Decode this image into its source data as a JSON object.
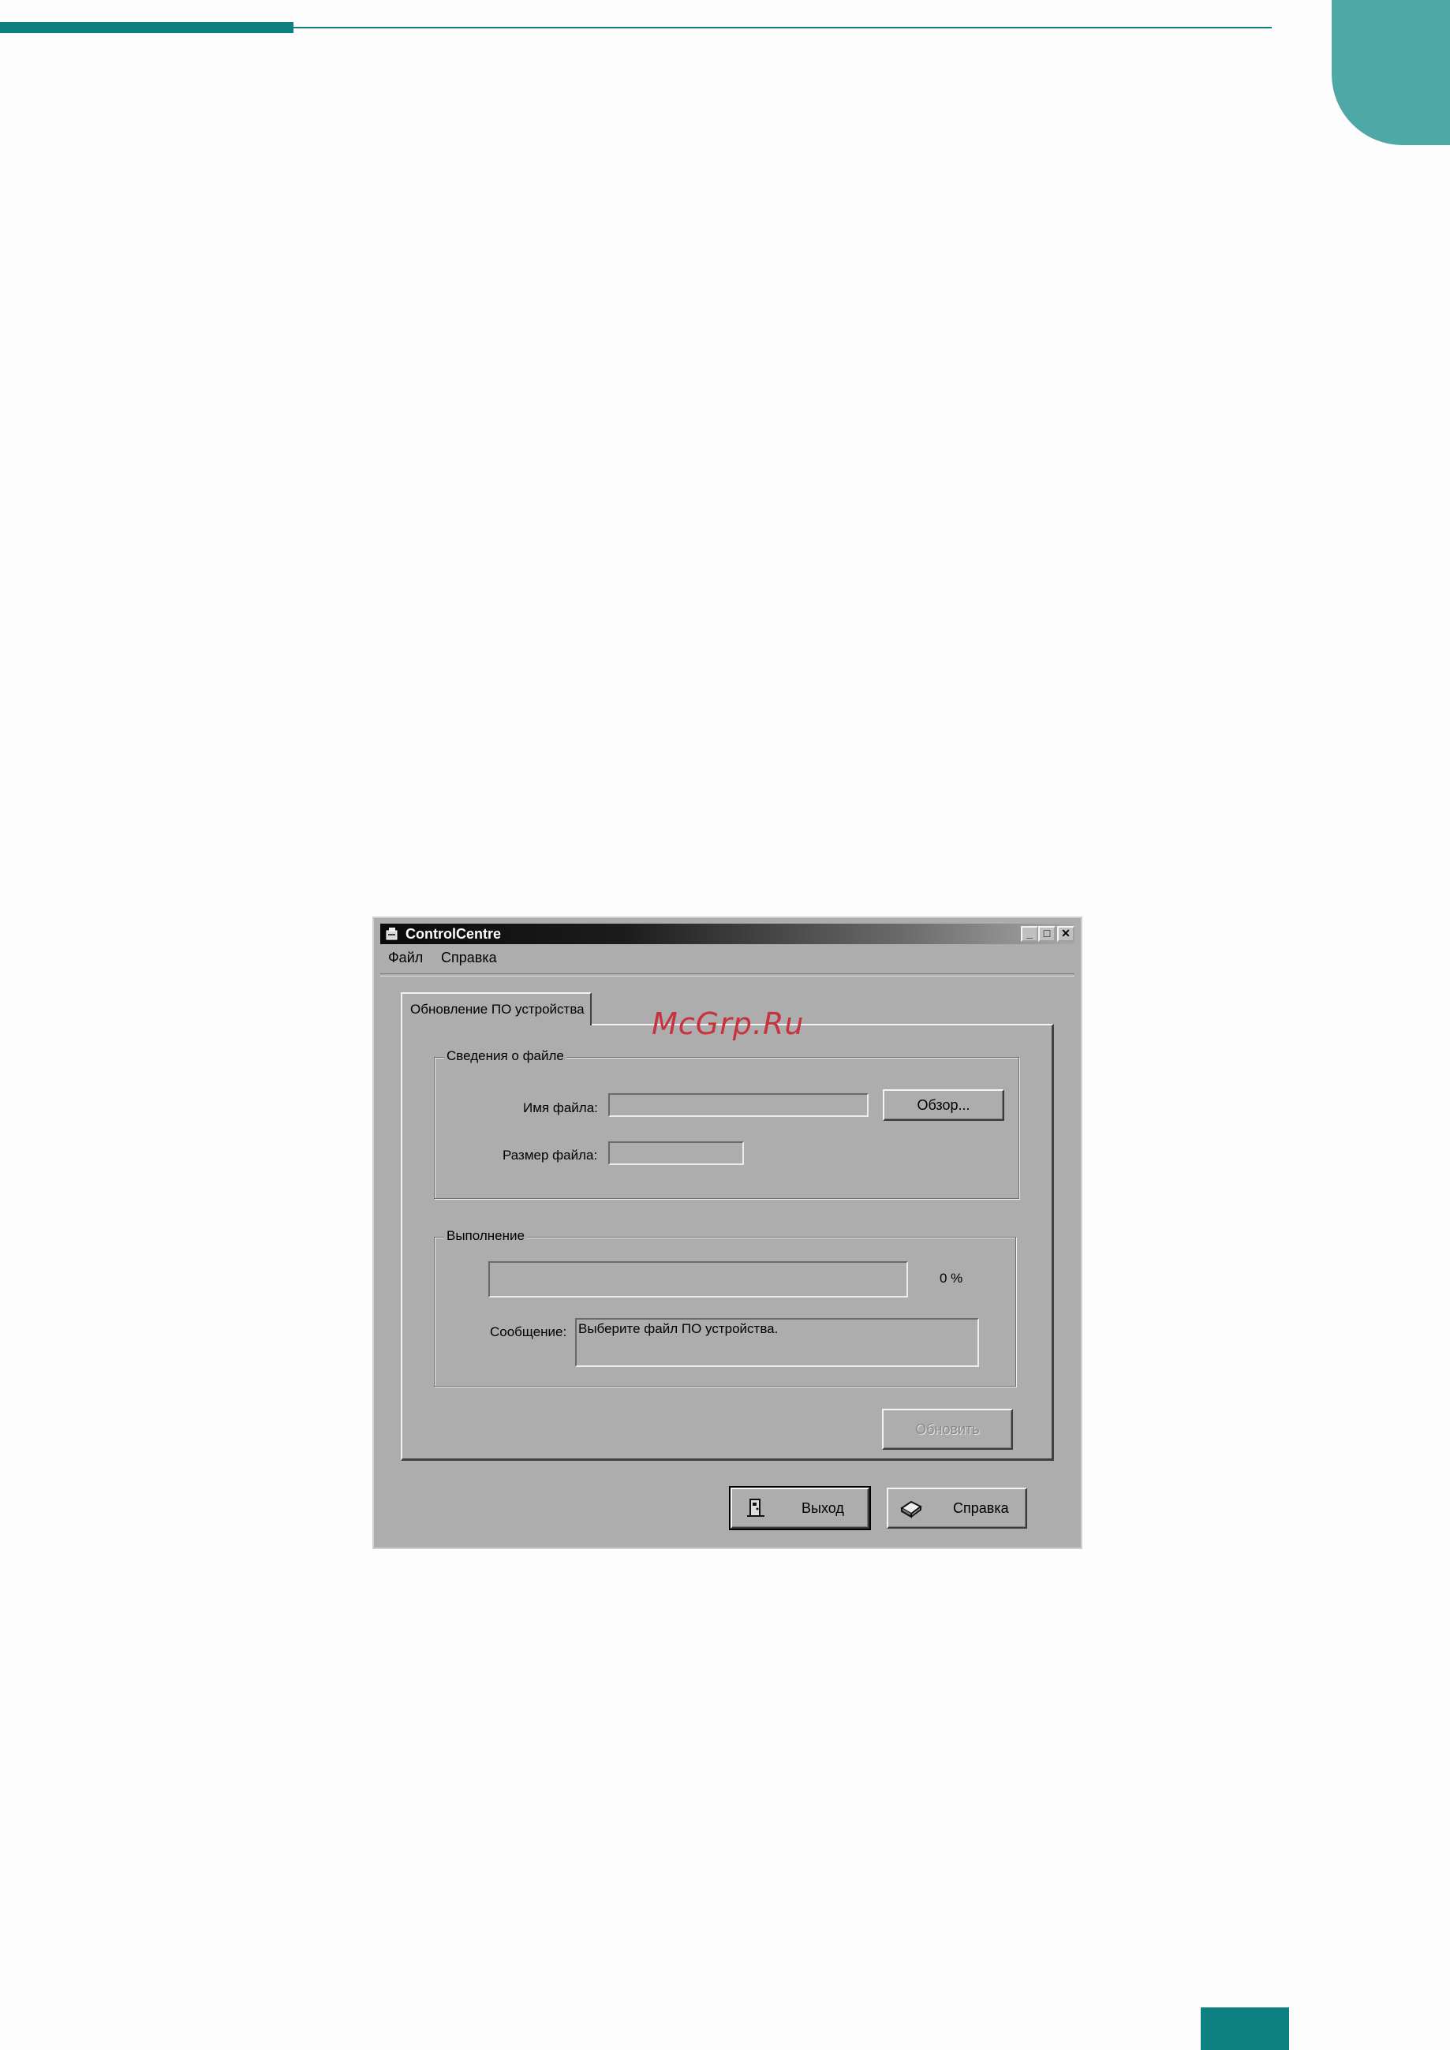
{
  "window": {
    "title": "ControlCentre",
    "minimize_glyph": "_",
    "maximize_glyph": "□",
    "close_glyph": "✕"
  },
  "menu": [
    "Файл",
    "Справка"
  ],
  "tab": {
    "label": "Обновление ПО устройства"
  },
  "file_info": {
    "group_title": "Сведения о файле",
    "file_name_label": "Имя файла:",
    "file_name_value": "",
    "browse_label": "Обзор...",
    "file_size_label": "Размер файла:",
    "file_size_value": ""
  },
  "progress": {
    "group_title": "Выполнение",
    "percent_text": "0 %",
    "percent_value": 0,
    "message_label": "Сообщение:",
    "message_text": "Выберите файл ПО устройства."
  },
  "update_button": {
    "label": "Обновить",
    "enabled": false
  },
  "exit_button": {
    "label": "Выход",
    "icon": "door-exit-icon"
  },
  "help_button": {
    "label": "Справка",
    "icon": "book-icon"
  },
  "watermark": "McGrp.Ru",
  "colors": {
    "accent": "#0e8082",
    "corner": "#4ea8a5",
    "window_bg": "#adadad"
  }
}
